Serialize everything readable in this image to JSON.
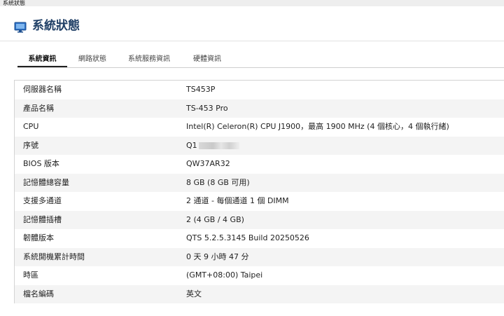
{
  "window": {
    "title": "系統狀態"
  },
  "header": {
    "title": "系統狀態",
    "icon": "monitor-icon"
  },
  "tabs": [
    {
      "label": "系統資訊",
      "active": true
    },
    {
      "label": "網路狀態",
      "active": false
    },
    {
      "label": "系統服務資訊",
      "active": false
    },
    {
      "label": "硬體資訊",
      "active": false
    }
  ],
  "system_info": {
    "rows": [
      {
        "label": "伺服器名稱",
        "value": "TS453P"
      },
      {
        "label": "產品名稱",
        "value": "TS-453 Pro"
      },
      {
        "label": "CPU",
        "value": "Intel(R) Celeron(R) CPU J1900，最高 1900 MHz (4 個核心，4 個執行緒)"
      },
      {
        "label": "序號",
        "value": "Q1"
      },
      {
        "label": "BIOS 版本",
        "value": "QW37AR32"
      },
      {
        "label": "記憶體總容量",
        "value": "8 GB (8 GB 可用)"
      },
      {
        "label": "支援多通道",
        "value": "2 通道 - 每個通道 1 個 DIMM"
      },
      {
        "label": "記憶體插槽",
        "value": "2 (4 GB / 4 GB)"
      },
      {
        "label": "韌體版本",
        "value": "QTS 5.2.5.3145 Build 20250526"
      },
      {
        "label": "系統開機累計時間",
        "value": "0 天 9 小時 47 分"
      },
      {
        "label": "時區",
        "value": "(GMT+08:00) Taipei"
      },
      {
        "label": "檔名編碼",
        "value": "英文"
      }
    ]
  }
}
